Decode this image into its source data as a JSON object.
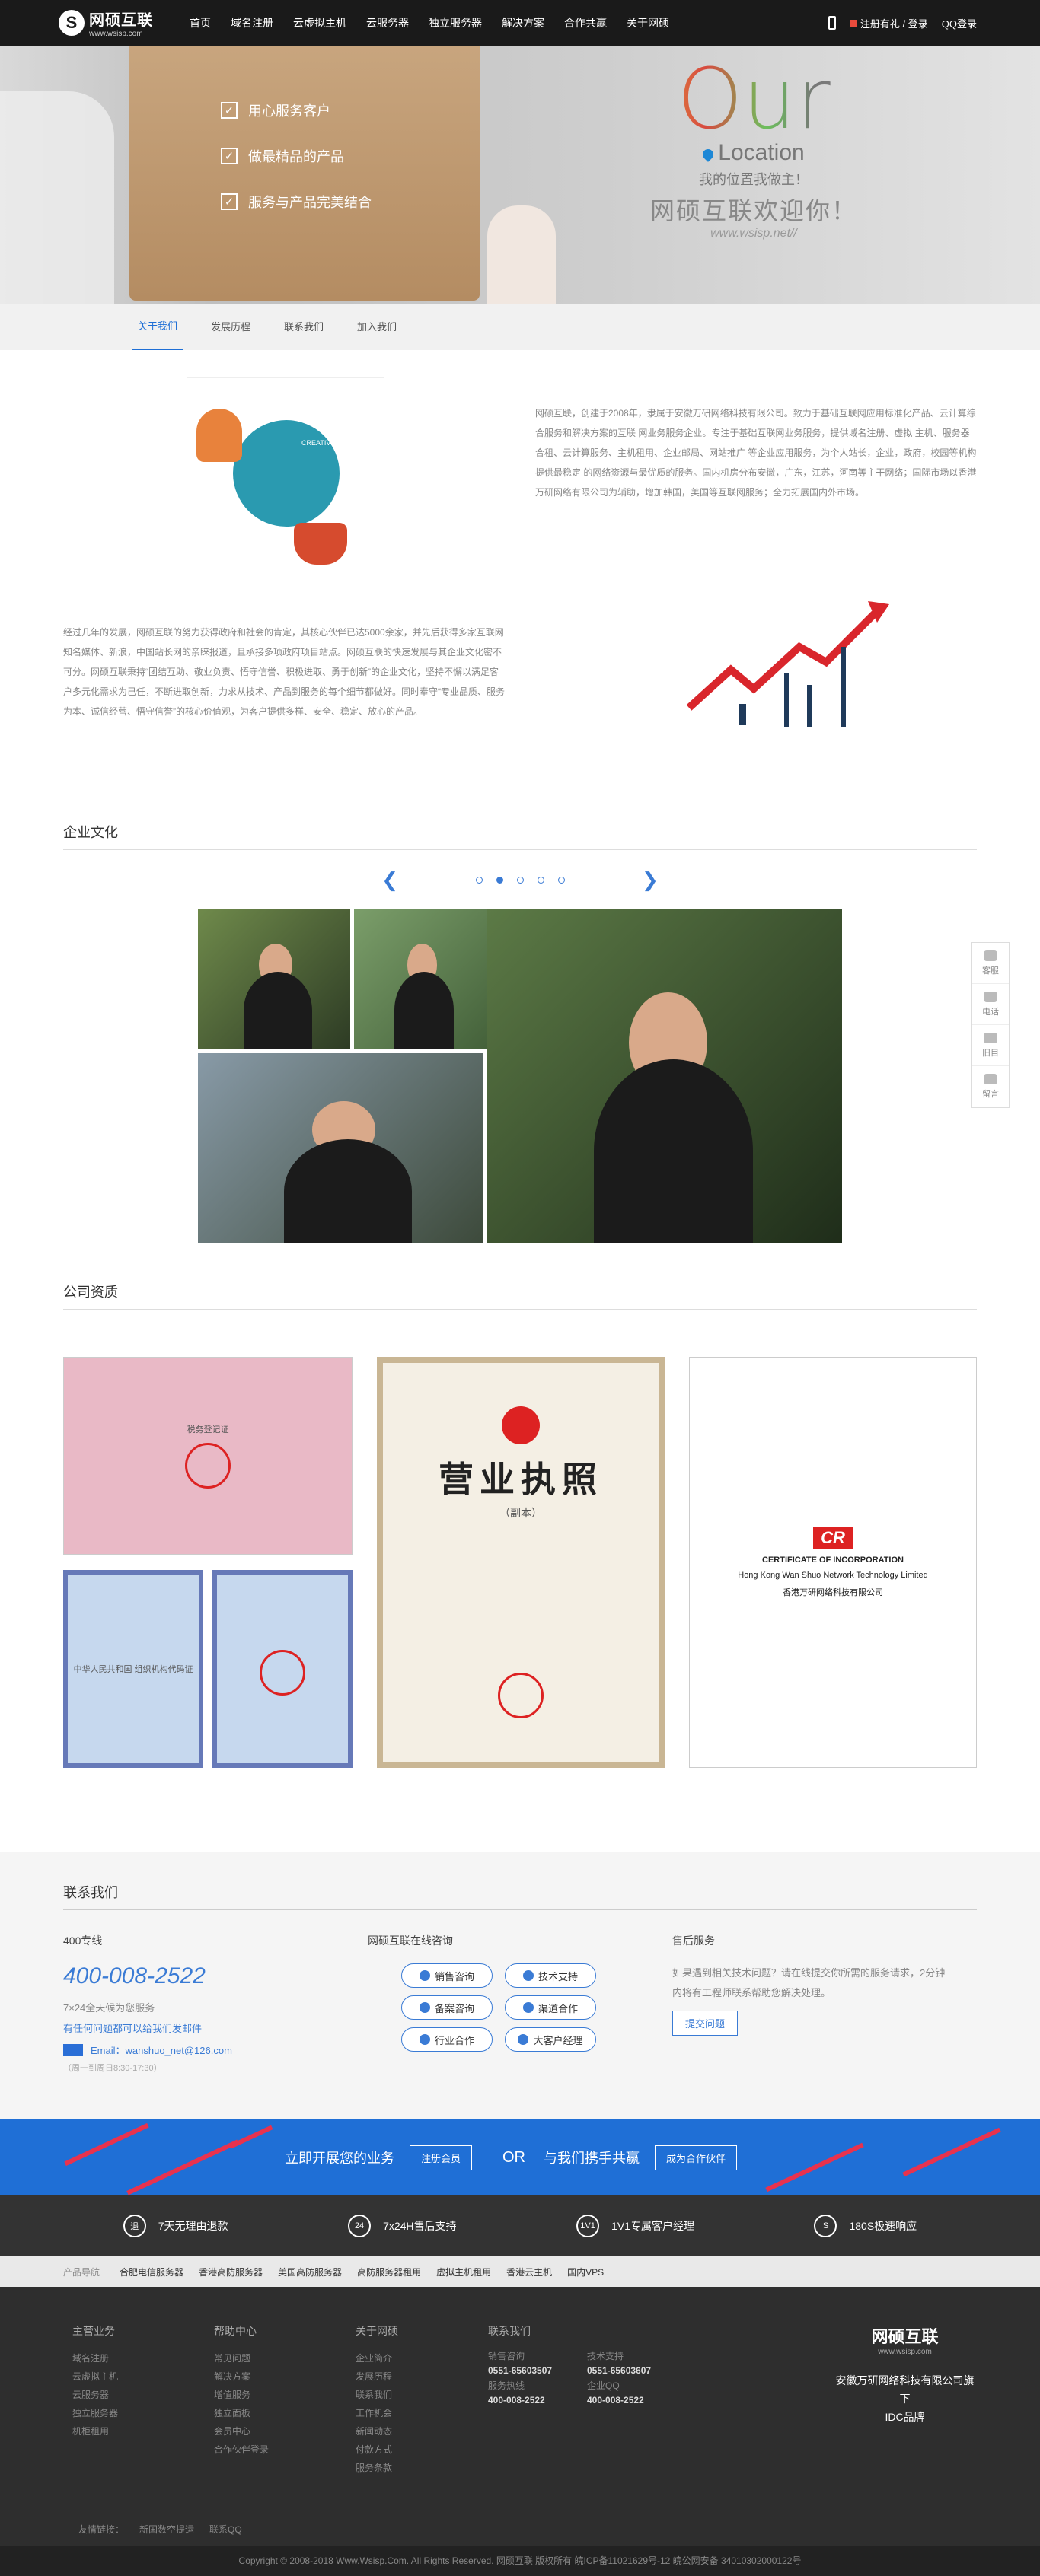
{
  "header": {
    "logo_name": "网硕互联",
    "logo_url": "www.wsisp.com",
    "nav": [
      "首页",
      "域名注册",
      "云虚拟主机",
      "云服务器",
      "独立服务器",
      "解决方案",
      "合作共赢",
      "关于网硕"
    ],
    "register": "注册有礼 / 登录",
    "qq_login": "QQ登录"
  },
  "banner": {
    "checks": [
      "用心服务客户",
      "做最精品的产品",
      "服务与产品完美结合"
    ],
    "our": "Our",
    "location": "Location",
    "slogan1": "我的位置我做主！",
    "slogan2": "网硕互联欢迎你！",
    "slogan3": "www.wsisp.net//"
  },
  "subnav": [
    "关于我们",
    "发展历程",
    "联系我们",
    "加入我们"
  ],
  "intro": {
    "badge": "CREATIVE TEAM",
    "text": "网硕互联，创建于2008年，隶属于安徽万研网络科技有限公司。致力于基础互联网应用标准化产品、云计算综合服务和解决方案的互联 网业务服务企业。专注于基础互联网业务服务，提供域名注册、虚拟 主机、服务器合租、云计算服务、主机租用、企业邮局、网站推广 等企业应用服务，为个人站长，企业，政府，校园等机构提供最稳定 的网络资源与最优质的服务。国内机房分布安徽，广东，江苏，河南等主干网络；国际市场以香港万研网络有限公司为辅助，增加韩国，美国等互联网服务；全力拓展国内外市场。"
  },
  "story": {
    "text": "经过几年的发展，网硕互联的努力获得政府和社会的肯定，其核心伙伴已达5000余家，并先后获得多家互联网知名媒体、新浪，中国站长网的亲睐报道，且承接多项政府项目站点。网硕互联的快速发展与其企业文化密不可分。网硕互联秉持“团结互助、敬业负责、悟守信誉、积极进取、勇于创新”的企业文化，坚持不懈以满足客户多元化需求为己任，不断进取创新，力求从技术、产品到服务的每个细节都做好。同时奉守“专业品质、服务为本、诚信经营、悟守信誉”的核心价值观，为客户提供多样、安全、稳定、放心的产品。"
  },
  "culture": {
    "title": "企业文化"
  },
  "quals": {
    "title": "公司资质",
    "license_big": "营业执照",
    "license_sub": "（副本）",
    "org_title": "中华人民共和国 组织机构代码证",
    "tax_title": "税务登记证",
    "hk_cr": "CR",
    "hk_title": "CERTIFICATE OF INCORPORATION",
    "hk_company": "Hong Kong Wan Shuo Network Technology Limited",
    "hk_cn": "香港万研网络科技有限公司"
  },
  "contact": {
    "title": "联系我们",
    "hotline_label": "400专线",
    "hotline": "400-008-2522",
    "service_hours": "7×24全天候为您服务",
    "suggest": "有任何问题都可以给我们发邮件",
    "email": "Email：wanshuo_net@126.com",
    "hours": "（周一到周日8:30-17:30）",
    "online_label": "网硕互联在线咨询",
    "buttons": [
      "销售咨询",
      "技术支持",
      "备案咨询",
      "渠道合作",
      "行业合作",
      "大客户经理"
    ],
    "after_label": "售后服务",
    "after_text": "如果遇到相关技术问题？请在线提交你所需的服务请求，2分钟内将有工程师联系帮助您解决处理。",
    "after_btn": "提交问题"
  },
  "promo": {
    "left": "立即开展您的业务",
    "btn1": "注册会员",
    "or": "OR",
    "right": "与我们携手共赢",
    "btn2": "成为合作伙伴"
  },
  "features": [
    {
      "icon": "refund-icon",
      "glyph": "退",
      "text": "7天无理由退款"
    },
    {
      "icon": "clock-icon",
      "glyph": "24",
      "text": "7x24H售后支持"
    },
    {
      "icon": "service-icon",
      "glyph": "1V1",
      "text": "1V1专属客户经理"
    },
    {
      "icon": "speed-icon",
      "glyph": "S",
      "text": "180S极速响应"
    }
  ],
  "prodnav": {
    "label": "产品导航",
    "items": [
      "合肥电信服务器",
      "香港高防服务器",
      "美国高防服务器",
      "高防服务器租用",
      "虚拟主机租用",
      "香港云主机",
      "国内VPS"
    ]
  },
  "footer": {
    "cols": [
      {
        "title": "主营业务",
        "items": [
          "域名注册",
          "云虚拟主机",
          "云服务器",
          "独立服务器",
          "机柜租用"
        ]
      },
      {
        "title": "帮助中心",
        "items": [
          "常见问题",
          "解决方案",
          "增值服务",
          "独立面板",
          "会员中心",
          "合作伙伴登录"
        ]
      },
      {
        "title": "关于网硕",
        "items": [
          "企业简介",
          "发展历程",
          "联系我们",
          "工作机会",
          "新闻动态",
          "付款方式",
          "服务条款"
        ]
      }
    ],
    "contact_title": "联系我们",
    "contact_items": [
      {
        "label": "销售咨询",
        "number": "0551-65603507"
      },
      {
        "label": "技术支持",
        "number": "0551-65603607"
      },
      {
        "label": "服务热线",
        "number": "400-008-2522"
      },
      {
        "label": "企业QQ",
        "number": "400-008-2522"
      }
    ],
    "logo_name": "网硕互联",
    "logo_url": "www.wsisp.com",
    "caption1": "安徽万研网络科技有限公司旗下",
    "caption2": "IDC品牌",
    "friend_label": "友情链接：",
    "friends": [
      "新国数空提运",
      "联系QQ"
    ],
    "copyright": "Copyright © 2008-2018 Www.Wsisp.Com. All Rights Reserved. 网硕互联 版权所有 皖ICP备11021629号-12 皖公网安备 34010302000122号"
  },
  "side": [
    "客服",
    "电话",
    "旧目",
    "留言"
  ]
}
